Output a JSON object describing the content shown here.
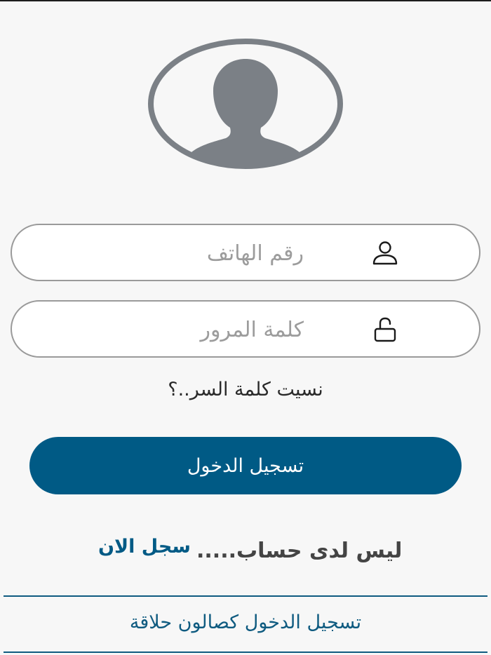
{
  "login": {
    "phone_placeholder": "رقم الهاتف",
    "password_placeholder": "كلمة المرور",
    "forgot_password": "نسيت كلمة السر..؟",
    "login_button": "تسجيل الدخول",
    "no_account": "ليس لدى حساب.....",
    "register_now": "سجل الان",
    "salon_login": "تسجيل الدخول كصالون حلاقة"
  },
  "icons": {
    "avatar": "user-avatar-icon",
    "phone_field": "user-icon",
    "password_field": "unlock-icon"
  },
  "colors": {
    "background": "#f7f7f7",
    "primary": "#005a85",
    "avatar_gray": "#7b8086",
    "field_border": "#9a9a9a",
    "placeholder": "#9c9c9c"
  }
}
